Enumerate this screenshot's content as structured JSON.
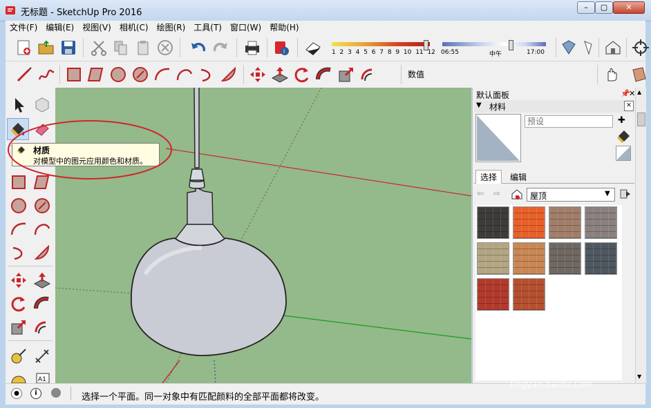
{
  "window": {
    "title": "无标题 - SketchUp Pro 2016"
  },
  "menu": [
    "文件(F)",
    "编辑(E)",
    "视图(V)",
    "相机(C)",
    "绘图(R)",
    "工具(T)",
    "窗口(W)",
    "帮助(H)"
  ],
  "shadow": {
    "months": [
      "1",
      "2",
      "3",
      "4",
      "5",
      "6",
      "7",
      "8",
      "9",
      "10",
      "11",
      "12"
    ],
    "time_start": "06:55",
    "time_mid": "中午",
    "time_end": "17:00"
  },
  "measurements": {
    "label": "数值"
  },
  "tooltip": {
    "title": "材质",
    "desc": "对模型中的图元应用颜色和材质。"
  },
  "panel": {
    "title": "默认面板",
    "section": "材料",
    "material_name_placeholder": "预设",
    "tab_select": "选择",
    "tab_edit": "编辑",
    "category": "屋顶",
    "swatch_colors": [
      "#3e3c3a",
      "#e8612a",
      "#a07e6a",
      "#8a817f",
      "#b2a582",
      "#c88754",
      "#6f6761",
      "#4f5860",
      "#b23a2c",
      "#b5502f"
    ]
  },
  "status": {
    "text": "选择一个平面。同一对象中有匹配颜料的全部平面都将改变。"
  },
  "watermark": {
    "brand": "Baidu经验",
    "url": "jingyan.baidu.com"
  }
}
